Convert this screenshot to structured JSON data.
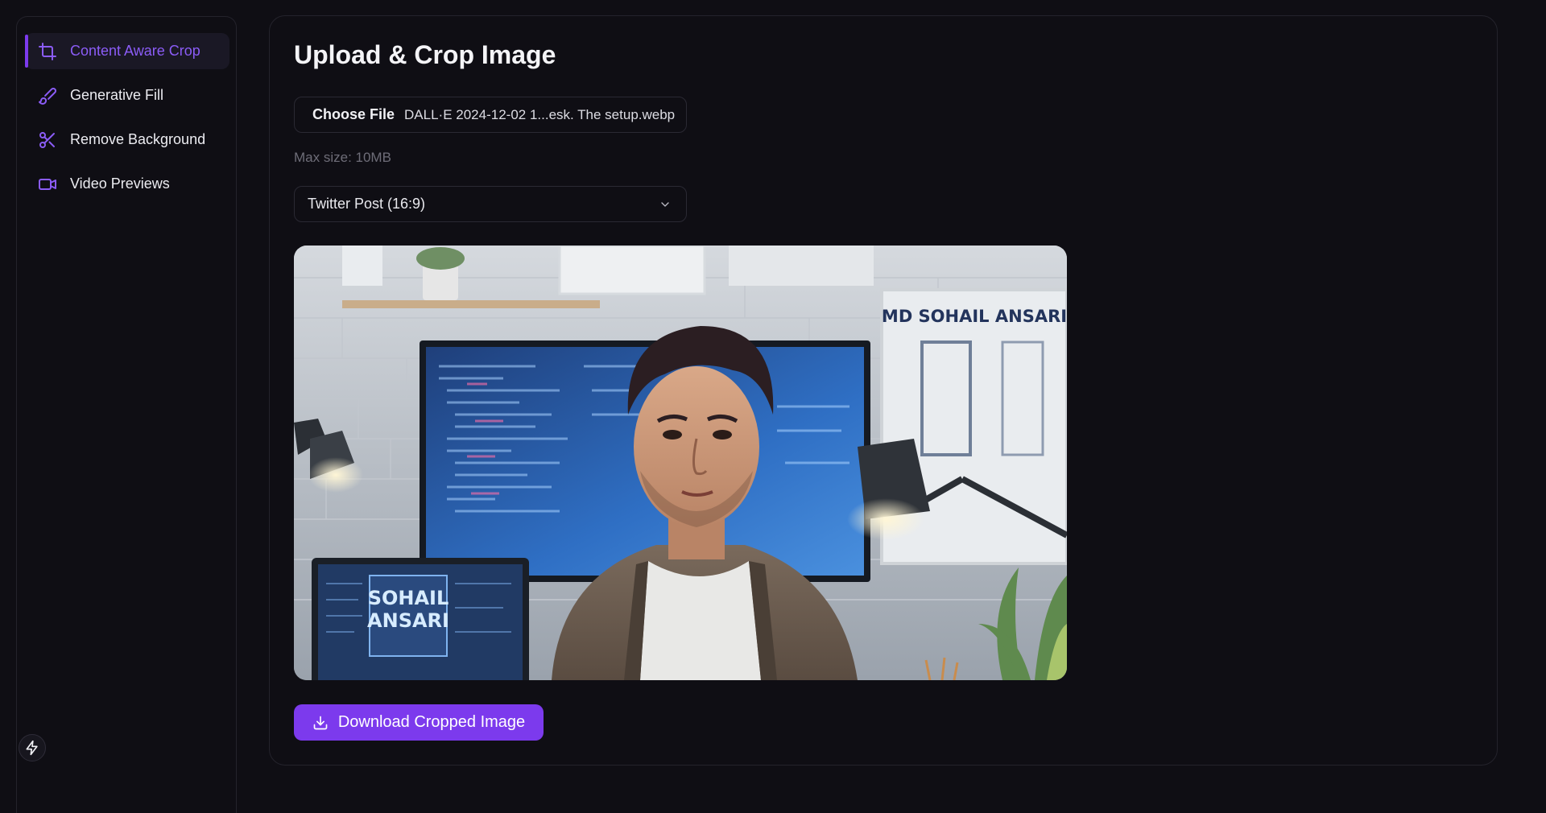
{
  "sidebar": {
    "items": [
      {
        "label": "Content Aware Crop",
        "icon": "crop-icon",
        "active": true
      },
      {
        "label": "Generative Fill",
        "icon": "brush-icon",
        "active": false
      },
      {
        "label": "Remove Background",
        "icon": "scissors-icon",
        "active": false
      },
      {
        "label": "Video Previews",
        "icon": "video-icon",
        "active": false
      }
    ],
    "footer_icon": "bolt-icon"
  },
  "main": {
    "title": "Upload & Crop Image",
    "file_input": {
      "button_label": "Choose File",
      "file_name": "DALL·E 2024-12-02 1...esk. The setup.webp"
    },
    "max_size": "Max size: 10MB",
    "format_select": {
      "selected": "Twitter Post (16:9)"
    },
    "preview": {
      "poster_text": "MD SOHAIL ANSARI",
      "laptop_text_line1": "SOHAIL",
      "laptop_text_line2": "ANSARI"
    },
    "download_label": "Download Cropped Image"
  },
  "colors": {
    "accent": "#7c3aed",
    "accent_text": "#8b5cf6",
    "background": "#0f0e14",
    "border": "#24232c"
  }
}
